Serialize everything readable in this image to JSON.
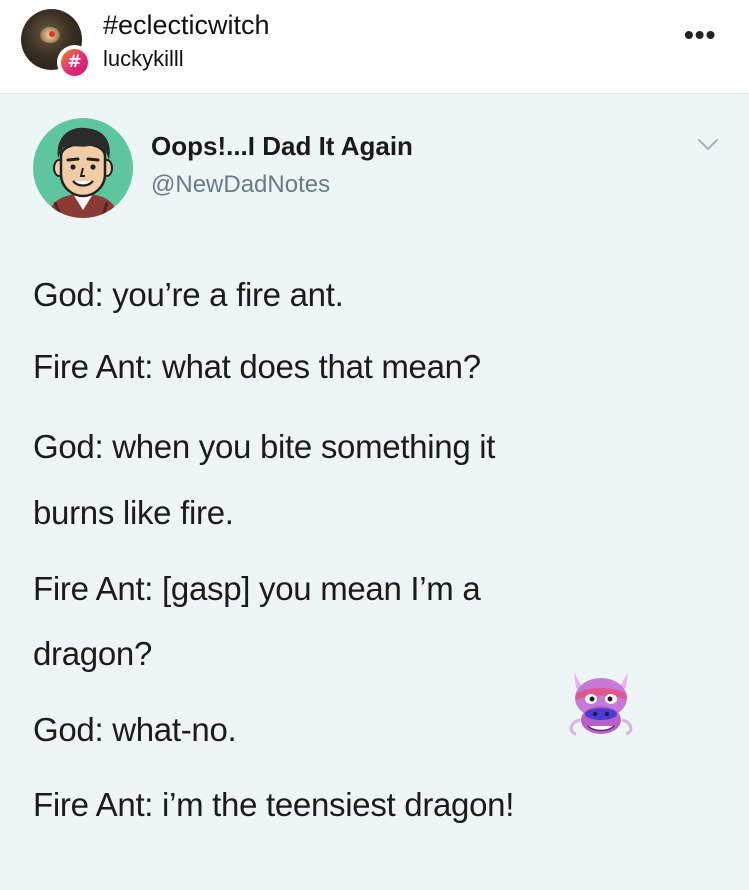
{
  "post_header": {
    "hashtag": "#eclecticwitch",
    "username": "luckykilll",
    "badge_symbol": "#",
    "more_label": "•••"
  },
  "tweet": {
    "display_name": "Oops!...I Dad It Again",
    "handle": "@NewDadNotes",
    "lines": [
      "God: you’re a fire ant.",
      "Fire Ant: what does that mean?",
      "God: when you bite something it",
      "burns like fire.",
      "Fire Ant: [gasp] you mean I’m a",
      "dragon?",
      "God: what-no.",
      "Fire Ant: i’m the teensiest dragon!"
    ],
    "emoji": "dragon-face-emoji"
  },
  "colors": {
    "tweet_background": "#eef5f7",
    "avatar_background": "#5fc59f",
    "badge_gradient_start": "#f58529",
    "badge_gradient_end": "#c4236a",
    "handle_color": "#6b7a86"
  }
}
